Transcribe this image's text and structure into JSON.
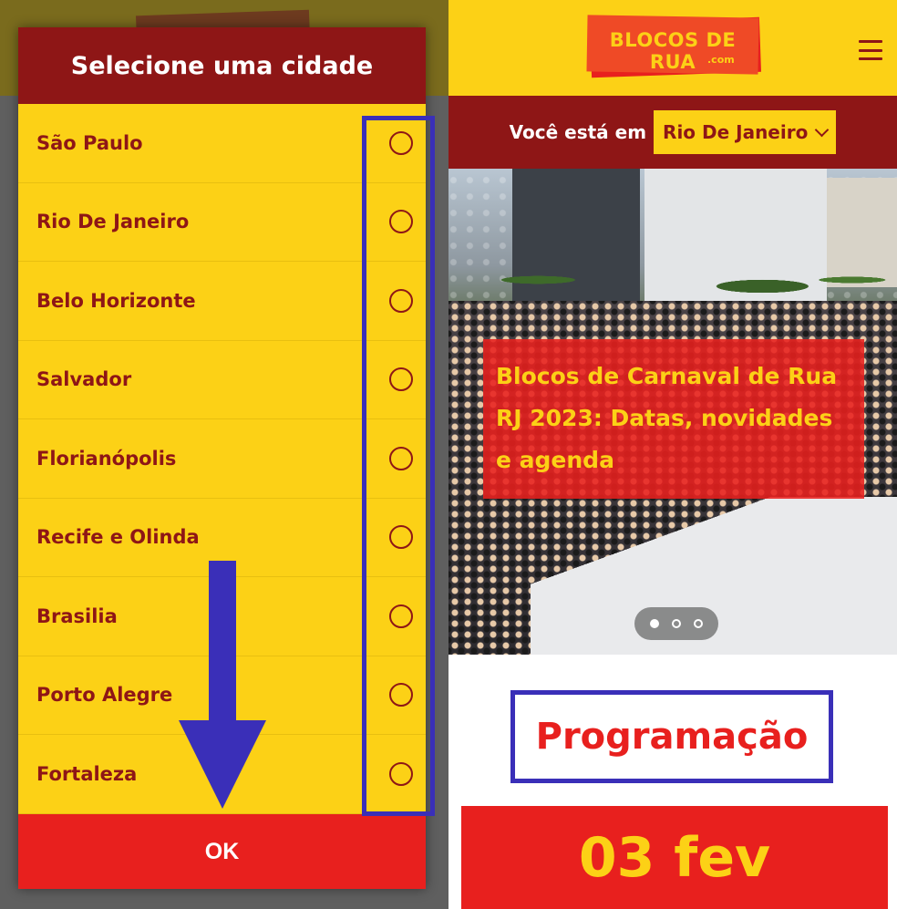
{
  "dialog": {
    "title": "Selecione uma cidade",
    "cities": [
      {
        "label": "São Paulo"
      },
      {
        "label": "Rio De Janeiro"
      },
      {
        "label": "Belo Horizonte"
      },
      {
        "label": "Salvador"
      },
      {
        "label": "Florianópolis"
      },
      {
        "label": "Recife e Olinda"
      },
      {
        "label": "Brasilia"
      },
      {
        "label": "Porto Alegre"
      },
      {
        "label": "Fortaleza"
      }
    ],
    "ok_label": "OK"
  },
  "site": {
    "logo_text": "BLOCOS DE RUA",
    "logo_suffix": ".com",
    "city_bar_label": "Você está em",
    "selected_city": "Rio De Janeiro",
    "hero_caption": "Blocos de Carnaval de Rua RJ 2023: Datas, novidades e agenda",
    "carousel": {
      "count": 3,
      "active": 1
    },
    "section_title": "Programação",
    "date_label": "03 fev"
  },
  "colors": {
    "yellow": "#fcd116",
    "dark_red": "#8e1616",
    "red": "#e8201e",
    "annotation_blue": "#3a2fb8"
  },
  "icons": {
    "menu": "hamburger-menu-icon",
    "select": "chevron-down-icon",
    "radio": "radio-unchecked-icon",
    "annotation": "arrow-down-icon"
  }
}
